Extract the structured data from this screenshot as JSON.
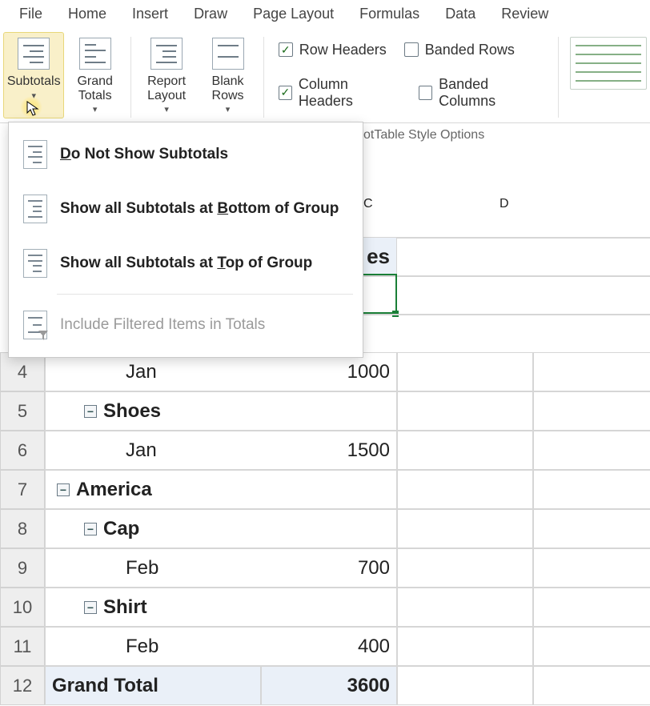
{
  "menubar": [
    "File",
    "Home",
    "Insert",
    "Draw",
    "Page Layout",
    "Formulas",
    "Data",
    "Review"
  ],
  "ribbon": {
    "subtotals": "Subtotals",
    "grand_totals_l1": "Grand",
    "grand_totals_l2": "Totals",
    "report_l1": "Report",
    "report_l2": "Layout",
    "blank_l1": "Blank",
    "blank_l2": "Rows",
    "row_headers": "Row Headers",
    "column_headers": "Column Headers",
    "banded_rows": "Banded Rows",
    "banded_columns": "Banded Columns",
    "group_caption_suffix": "otTable Style Options"
  },
  "dropdown": {
    "no_subtotals_pre": "",
    "no_subtotals_u": "D",
    "no_subtotals_post": "o Not Show Subtotals",
    "bottom_pre": "Show all Subtotals at ",
    "bottom_u": "B",
    "bottom_post": "ottom of Group",
    "top_pre": "Show all Subtotals at ",
    "top_u": "T",
    "top_post": "op of Group",
    "filtered": "Include Filtered Items in Totals"
  },
  "columns": {
    "c": "C",
    "d": "D"
  },
  "grid": {
    "pivot_header_suffix": "es",
    "rows": [
      {
        "num": "4",
        "a_text": "Jan",
        "a_bold": false,
        "indent": 3,
        "expander": false,
        "b": "1000"
      },
      {
        "num": "5",
        "a_text": "Shoes",
        "a_bold": true,
        "indent": 2,
        "expander": true,
        "b": ""
      },
      {
        "num": "6",
        "a_text": "Jan",
        "a_bold": false,
        "indent": 3,
        "expander": false,
        "b": "1500"
      },
      {
        "num": "7",
        "a_text": "America",
        "a_bold": true,
        "indent": 1,
        "expander": true,
        "b": ""
      },
      {
        "num": "8",
        "a_text": "Cap",
        "a_bold": true,
        "indent": 2,
        "expander": true,
        "b": ""
      },
      {
        "num": "9",
        "a_text": "Feb",
        "a_bold": false,
        "indent": 3,
        "expander": false,
        "b": "700"
      },
      {
        "num": "10",
        "a_text": "Shirt",
        "a_bold": true,
        "indent": 2,
        "expander": true,
        "b": ""
      },
      {
        "num": "11",
        "a_text": "Feb",
        "a_bold": false,
        "indent": 3,
        "expander": false,
        "b": "400"
      },
      {
        "num": "12",
        "a_text": "Grand Total",
        "a_bold": true,
        "indent": 0,
        "expander": false,
        "b": "3600",
        "grand": true
      }
    ]
  }
}
